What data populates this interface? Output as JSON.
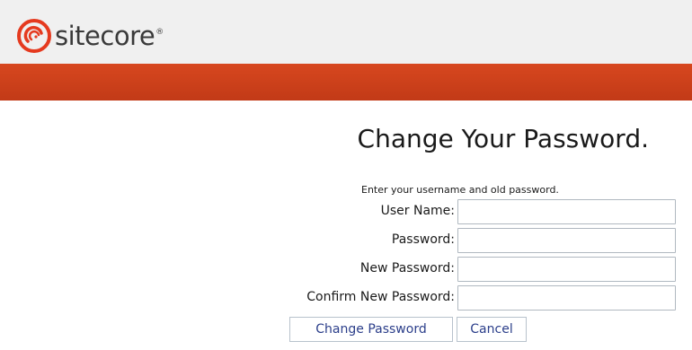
{
  "header": {
    "logo_text": "sitecore",
    "logo_mark": "®",
    "logo_icon": "sitecore-swirl-icon",
    "colors": {
      "header_bg": "#f0f0f0",
      "bar": "#d2431c",
      "logo_red": "#e53a1f"
    }
  },
  "form": {
    "title": "Change Your Password.",
    "instruction": "Enter your username and old password.",
    "fields": [
      {
        "label": "User Name:",
        "value": ""
      },
      {
        "label": "Password:",
        "value": ""
      },
      {
        "label": "New Password:",
        "value": ""
      },
      {
        "label": "Confirm New Password:",
        "value": ""
      }
    ],
    "submit_label": "Change Password",
    "cancel_label": "Cancel",
    "button_text_color": "#2b3e8a"
  }
}
